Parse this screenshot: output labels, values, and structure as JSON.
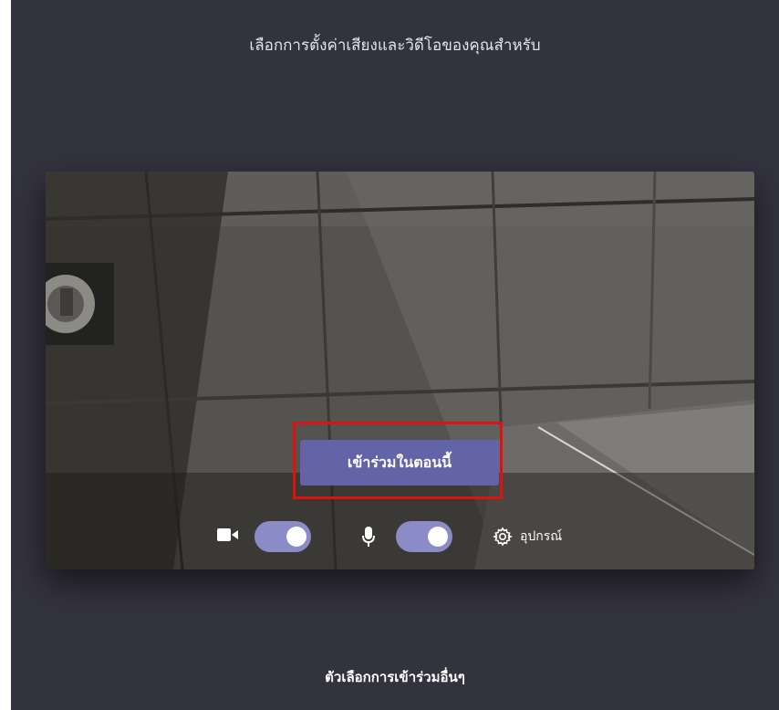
{
  "header": {
    "title": "เลือกการตั้งค่าเสียงและวิดีโอของคุณสำหรับ"
  },
  "preview": {
    "join_button_label": "เข้าร่วมในตอนนี้",
    "highlight_color": "#e0120f",
    "accent_color": "#6264a7"
  },
  "controls": {
    "camera": {
      "icon": "video-camera-icon",
      "enabled": true
    },
    "microphone": {
      "icon": "microphone-icon",
      "enabled": true
    },
    "devices": {
      "icon": "gear-icon",
      "label": "อุปกรณ์"
    }
  },
  "footer": {
    "other_join_options": "ตัวเลือกการเข้าร่วมอื่นๆ"
  }
}
